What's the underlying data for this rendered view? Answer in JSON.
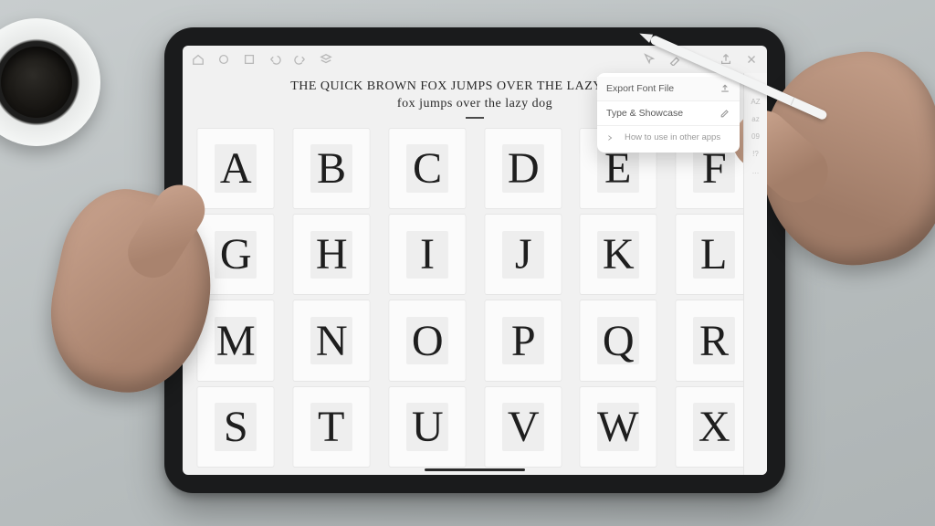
{
  "toolbar_left": [
    "home",
    "palette",
    "style",
    "undo",
    "redo",
    "layers"
  ],
  "toolbar_right": [
    "pointer",
    "brush",
    "eraser",
    "share",
    "close"
  ],
  "preview": {
    "line1": "THE QUICK BROWN FOX JUMPS OVER THE LAZY DOG, the",
    "line2": "fox jumps over the lazy dog"
  },
  "glyphs": [
    "A",
    "B",
    "C",
    "D",
    "E",
    "F",
    "G",
    "H",
    "I",
    "J",
    "K",
    "L",
    "M",
    "N",
    "O",
    "P",
    "Q",
    "R",
    "S",
    "T",
    "U",
    "V",
    "W",
    "X"
  ],
  "rail": [
    "⊕",
    "AZ",
    "az",
    "09",
    "!?",
    "…"
  ],
  "popover": {
    "items": [
      {
        "label": "Export Font File",
        "icon": "export"
      },
      {
        "label": "Type & Showcase",
        "icon": "edit"
      }
    ],
    "help": "How to use in other apps"
  }
}
